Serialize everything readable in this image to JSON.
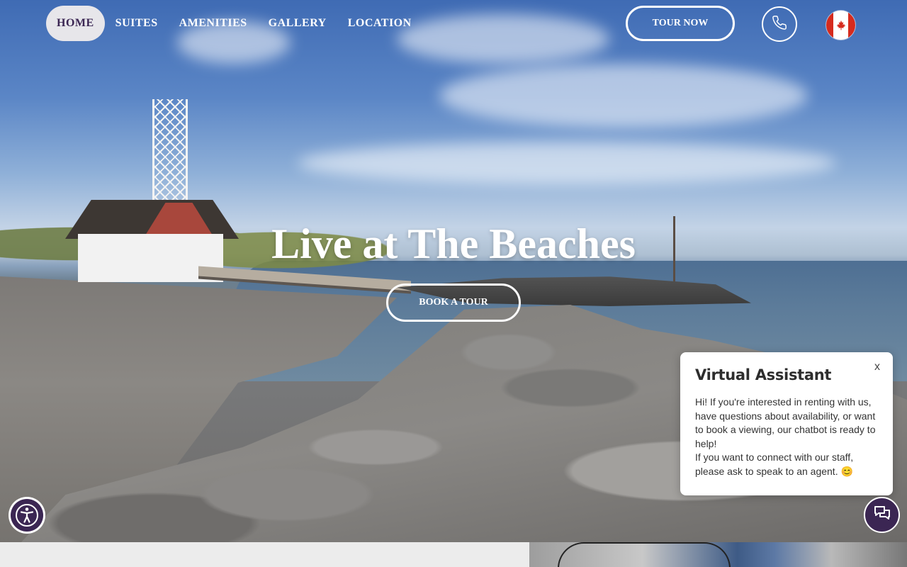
{
  "nav": {
    "items": [
      {
        "label": "HOME",
        "active": true
      },
      {
        "label": "SUITES",
        "active": false
      },
      {
        "label": "AMENITIES",
        "active": false
      },
      {
        "label": "GALLERY",
        "active": false
      },
      {
        "label": "LOCATION",
        "active": false
      }
    ],
    "tour_label": "TOUR NOW",
    "phone_icon": "phone-icon",
    "flag_icon": "canada-flag-icon"
  },
  "hero": {
    "title": "Live at The Beaches",
    "cta_label": "BOOK A TOUR"
  },
  "chat": {
    "title": "Virtual Assistant",
    "close_label": "x",
    "message_line1": "Hi! If you're interested in renting with us, have questions about availability, or want to book a viewing, our chatbot is ready to help!",
    "message_line2": "If you want to connect with our staff, please ask to speak to an agent. 😊"
  },
  "colors": {
    "brand_purple": "#3b2653",
    "active_nav_bg": "#e7e6ea",
    "white": "#ffffff"
  },
  "icons": {
    "accessibility": "accessibility-icon",
    "chat": "chat-bubble-icon"
  }
}
